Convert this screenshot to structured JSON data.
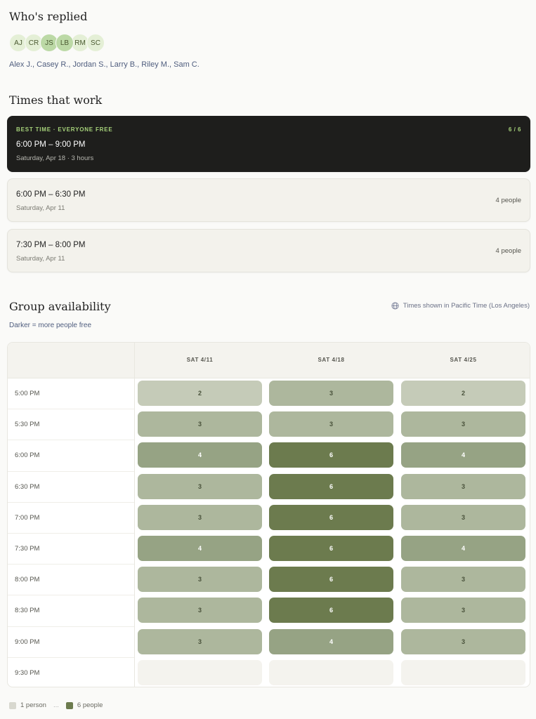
{
  "replied": {
    "title": "Who's replied",
    "avatars": [
      {
        "initials": "AJ",
        "strong": false
      },
      {
        "initials": "CR",
        "strong": false
      },
      {
        "initials": "JS",
        "strong": true
      },
      {
        "initials": "LB",
        "strong": true
      },
      {
        "initials": "RM",
        "strong": false
      },
      {
        "initials": "SC",
        "strong": false
      }
    ],
    "names": "Alex J., Casey R., Jordan S., Larry B., Riley M., Sam C."
  },
  "times": {
    "title": "Times that work",
    "best": {
      "tag": "BEST TIME · EVERYONE FREE",
      "ratio": "6 / 6",
      "range": "6:00 PM – 9:00 PM",
      "sub": "Saturday, Apr 18 · 3 hours"
    },
    "alternatives": [
      {
        "range": "6:00 PM – 6:30 PM",
        "sub": "Saturday, Apr 11",
        "count": "4 people"
      },
      {
        "range": "7:30 PM – 8:00 PM",
        "sub": "Saturday, Apr 11",
        "count": "4 people"
      }
    ]
  },
  "group": {
    "title": "Group availability",
    "hint": "Darker = more people free",
    "timezone": "Times shown in Pacific Time (Los Angeles)",
    "timezone_icon": "globe-icon",
    "max_people": 6,
    "columns": [
      "SAT 4/11",
      "SAT 4/18",
      "SAT 4/25"
    ],
    "rows": [
      {
        "time": "5:00 PM",
        "counts": [
          2,
          3,
          2
        ]
      },
      {
        "time": "5:30 PM",
        "counts": [
          3,
          3,
          3
        ]
      },
      {
        "time": "6:00 PM",
        "counts": [
          4,
          6,
          4
        ]
      },
      {
        "time": "6:30 PM",
        "counts": [
          3,
          6,
          3
        ]
      },
      {
        "time": "7:00 PM",
        "counts": [
          3,
          6,
          3
        ]
      },
      {
        "time": "7:30 PM",
        "counts": [
          4,
          6,
          4
        ]
      },
      {
        "time": "8:00 PM",
        "counts": [
          3,
          6,
          3
        ]
      },
      {
        "time": "8:30 PM",
        "counts": [
          3,
          6,
          3
        ]
      },
      {
        "time": "9:00 PM",
        "counts": [
          3,
          4,
          3
        ]
      },
      {
        "time": "9:30 PM",
        "counts": [
          null,
          null,
          null
        ]
      }
    ],
    "colors": {
      "0": "#f4f3ee",
      "2": "#c5cbb8",
      "3": "#adb79d",
      "4": "#96a384",
      "6": "#6c7b4e"
    },
    "text_colors": {
      "light": "#48513a",
      "dark": "#ffffff"
    }
  },
  "legend": {
    "low_label": "1 person",
    "low_color": "#d8d8cf",
    "dots": "...",
    "high_label": "6 people",
    "high_color": "#6c7b4e"
  }
}
